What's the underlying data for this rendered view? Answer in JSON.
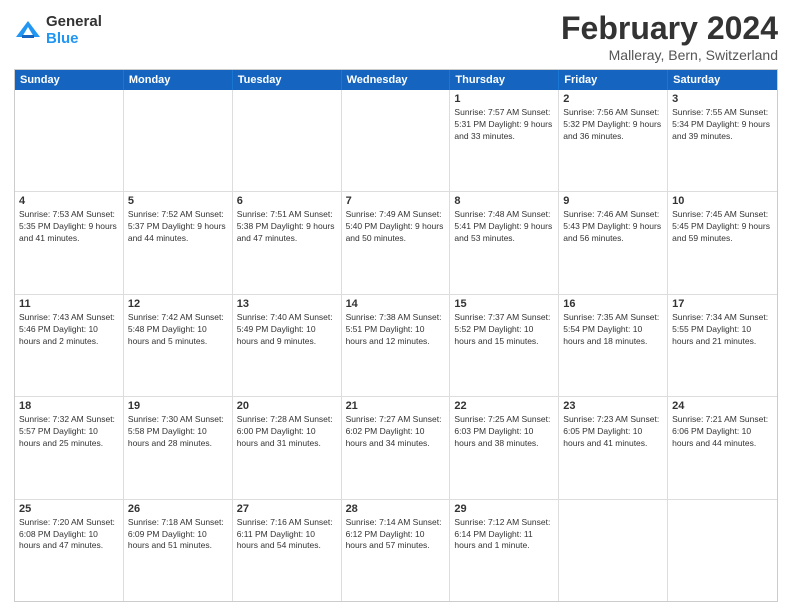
{
  "logo": {
    "general": "General",
    "blue": "Blue"
  },
  "title": {
    "month": "February 2024",
    "location": "Malleray, Bern, Switzerland"
  },
  "header_days": [
    "Sunday",
    "Monday",
    "Tuesday",
    "Wednesday",
    "Thursday",
    "Friday",
    "Saturday"
  ],
  "rows": [
    [
      {
        "day": "",
        "info": ""
      },
      {
        "day": "",
        "info": ""
      },
      {
        "day": "",
        "info": ""
      },
      {
        "day": "",
        "info": ""
      },
      {
        "day": "1",
        "info": "Sunrise: 7:57 AM\nSunset: 5:31 PM\nDaylight: 9 hours\nand 33 minutes."
      },
      {
        "day": "2",
        "info": "Sunrise: 7:56 AM\nSunset: 5:32 PM\nDaylight: 9 hours\nand 36 minutes."
      },
      {
        "day": "3",
        "info": "Sunrise: 7:55 AM\nSunset: 5:34 PM\nDaylight: 9 hours\nand 39 minutes."
      }
    ],
    [
      {
        "day": "4",
        "info": "Sunrise: 7:53 AM\nSunset: 5:35 PM\nDaylight: 9 hours\nand 41 minutes."
      },
      {
        "day": "5",
        "info": "Sunrise: 7:52 AM\nSunset: 5:37 PM\nDaylight: 9 hours\nand 44 minutes."
      },
      {
        "day": "6",
        "info": "Sunrise: 7:51 AM\nSunset: 5:38 PM\nDaylight: 9 hours\nand 47 minutes."
      },
      {
        "day": "7",
        "info": "Sunrise: 7:49 AM\nSunset: 5:40 PM\nDaylight: 9 hours\nand 50 minutes."
      },
      {
        "day": "8",
        "info": "Sunrise: 7:48 AM\nSunset: 5:41 PM\nDaylight: 9 hours\nand 53 minutes."
      },
      {
        "day": "9",
        "info": "Sunrise: 7:46 AM\nSunset: 5:43 PM\nDaylight: 9 hours\nand 56 minutes."
      },
      {
        "day": "10",
        "info": "Sunrise: 7:45 AM\nSunset: 5:45 PM\nDaylight: 9 hours\nand 59 minutes."
      }
    ],
    [
      {
        "day": "11",
        "info": "Sunrise: 7:43 AM\nSunset: 5:46 PM\nDaylight: 10 hours\nand 2 minutes."
      },
      {
        "day": "12",
        "info": "Sunrise: 7:42 AM\nSunset: 5:48 PM\nDaylight: 10 hours\nand 5 minutes."
      },
      {
        "day": "13",
        "info": "Sunrise: 7:40 AM\nSunset: 5:49 PM\nDaylight: 10 hours\nand 9 minutes."
      },
      {
        "day": "14",
        "info": "Sunrise: 7:38 AM\nSunset: 5:51 PM\nDaylight: 10 hours\nand 12 minutes."
      },
      {
        "day": "15",
        "info": "Sunrise: 7:37 AM\nSunset: 5:52 PM\nDaylight: 10 hours\nand 15 minutes."
      },
      {
        "day": "16",
        "info": "Sunrise: 7:35 AM\nSunset: 5:54 PM\nDaylight: 10 hours\nand 18 minutes."
      },
      {
        "day": "17",
        "info": "Sunrise: 7:34 AM\nSunset: 5:55 PM\nDaylight: 10 hours\nand 21 minutes."
      }
    ],
    [
      {
        "day": "18",
        "info": "Sunrise: 7:32 AM\nSunset: 5:57 PM\nDaylight: 10 hours\nand 25 minutes."
      },
      {
        "day": "19",
        "info": "Sunrise: 7:30 AM\nSunset: 5:58 PM\nDaylight: 10 hours\nand 28 minutes."
      },
      {
        "day": "20",
        "info": "Sunrise: 7:28 AM\nSunset: 6:00 PM\nDaylight: 10 hours\nand 31 minutes."
      },
      {
        "day": "21",
        "info": "Sunrise: 7:27 AM\nSunset: 6:02 PM\nDaylight: 10 hours\nand 34 minutes."
      },
      {
        "day": "22",
        "info": "Sunrise: 7:25 AM\nSunset: 6:03 PM\nDaylight: 10 hours\nand 38 minutes."
      },
      {
        "day": "23",
        "info": "Sunrise: 7:23 AM\nSunset: 6:05 PM\nDaylight: 10 hours\nand 41 minutes."
      },
      {
        "day": "24",
        "info": "Sunrise: 7:21 AM\nSunset: 6:06 PM\nDaylight: 10 hours\nand 44 minutes."
      }
    ],
    [
      {
        "day": "25",
        "info": "Sunrise: 7:20 AM\nSunset: 6:08 PM\nDaylight: 10 hours\nand 47 minutes."
      },
      {
        "day": "26",
        "info": "Sunrise: 7:18 AM\nSunset: 6:09 PM\nDaylight: 10 hours\nand 51 minutes."
      },
      {
        "day": "27",
        "info": "Sunrise: 7:16 AM\nSunset: 6:11 PM\nDaylight: 10 hours\nand 54 minutes."
      },
      {
        "day": "28",
        "info": "Sunrise: 7:14 AM\nSunset: 6:12 PM\nDaylight: 10 hours\nand 57 minutes."
      },
      {
        "day": "29",
        "info": "Sunrise: 7:12 AM\nSunset: 6:14 PM\nDaylight: 11 hours\nand 1 minute."
      },
      {
        "day": "",
        "info": ""
      },
      {
        "day": "",
        "info": ""
      }
    ]
  ]
}
